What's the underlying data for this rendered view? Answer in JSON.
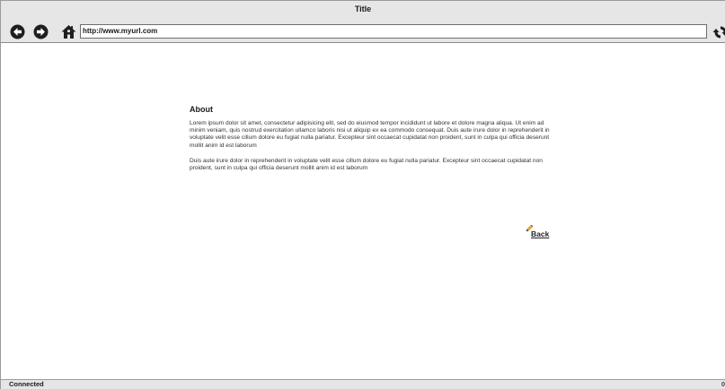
{
  "window": {
    "title": "Title"
  },
  "toolbar": {
    "back_icon": "arrow-left-circle-icon",
    "forward_icon": "arrow-right-circle-icon",
    "home_icon": "home-icon",
    "refresh_icon": "refresh-icon",
    "address_value": "http://www.myurl.com"
  },
  "page": {
    "heading": "About",
    "paragraphs": [
      "Lorem ipsum dolor sit amet, consectetur adipisicing elit, sed do eiusmod tempor incididunt ut labore et dolore magna aliqua. Ut enim ad minim veniam, quis nostrud exercitation ullamco laboris nisi ut aliquip ex ea commodo consequat. Duis aute irure dolor in reprehenderit in voluptate velit esse cillum dolore eu fugiat nulla pariatur. Excepteur sint occaecat cupidatat non proident, sunt in culpa qui officia deserunt mollit anim id est laborum",
      "Duis aute irure dolor in reprehenderit in voluptate velit esse cillum dolore eu fugiat nulla pariatur. Excepteur sint occaecat cupidatat non proident, sunt in culpa qui officia deserunt mollit anim id est laborum"
    ],
    "back_link": {
      "label": "Back",
      "icon": "pencil-icon"
    }
  },
  "statusbar": {
    "text": "Connected",
    "right_text": "0"
  },
  "colors": {
    "chrome_background": "#e6e6e6",
    "icon_fill": "#1e1e1e"
  }
}
